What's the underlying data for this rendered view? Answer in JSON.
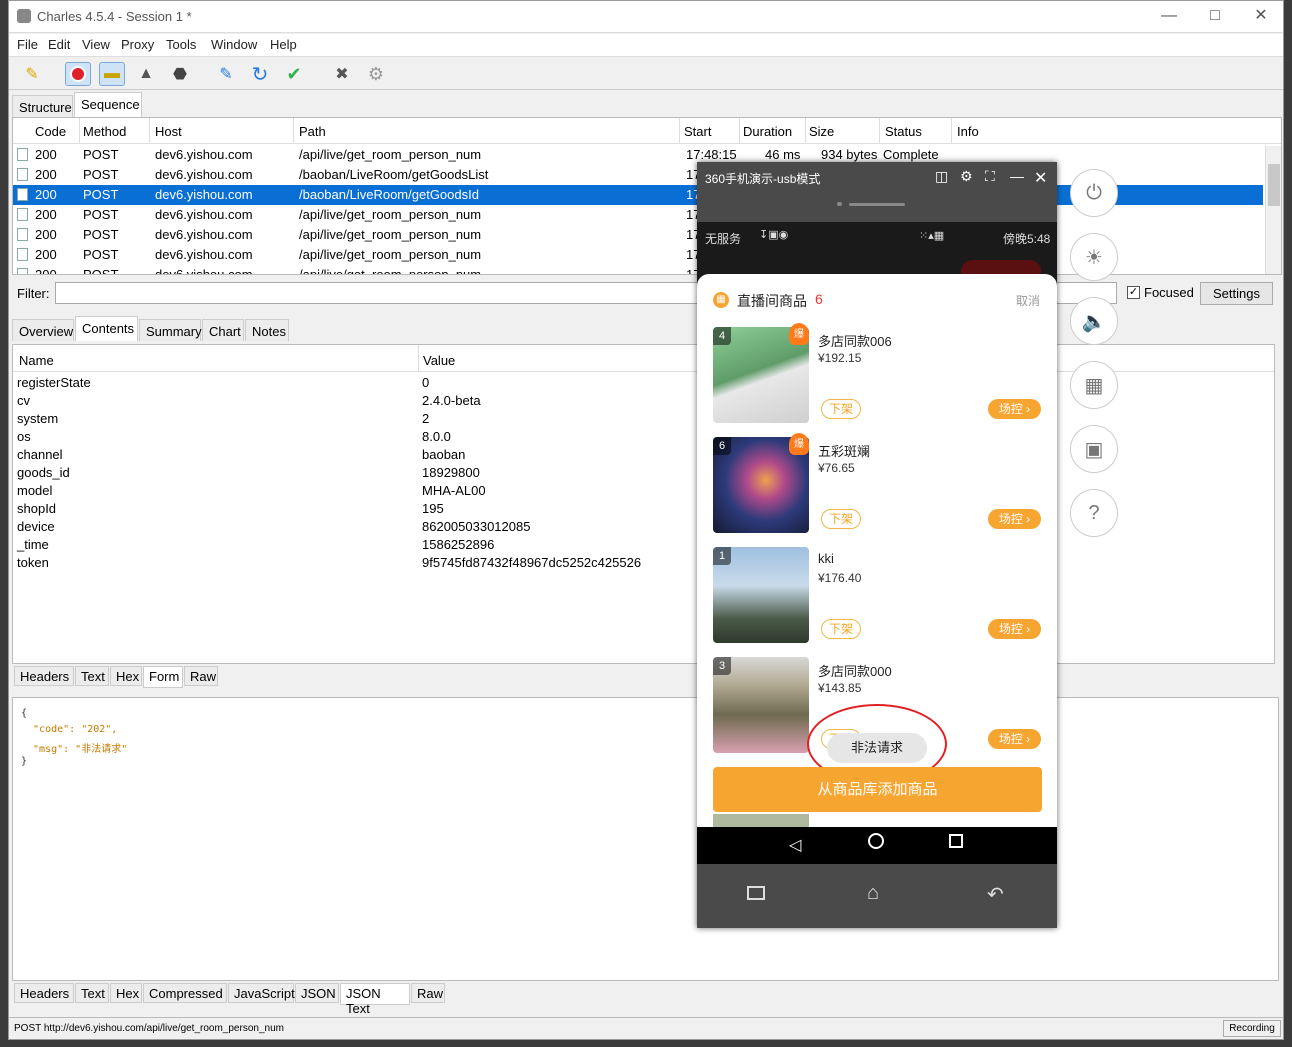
{
  "window": {
    "title": "Charles 4.5.4 - Session 1 *"
  },
  "menu": [
    "File",
    "Edit",
    "View",
    "Proxy",
    "Tools",
    "Window",
    "Help"
  ],
  "toolbar": {
    "icons": [
      "broom-icon",
      "record-icon",
      "throttle-icon",
      "turtle-icon",
      "stop-icon",
      "pen-icon",
      "refresh-icon",
      "check-icon",
      "tools-icon",
      "gear-icon"
    ]
  },
  "view_tabs": [
    "Structure",
    "Sequence"
  ],
  "sequence": {
    "columns": [
      "Code",
      "Method",
      "Host",
      "Path",
      "Start",
      "Duration",
      "Size",
      "Status",
      "Info"
    ],
    "rows": [
      {
        "code": "200",
        "method": "POST",
        "host": "dev6.yishou.com",
        "path": "/api/live/get_room_person_num",
        "start": "17:48:15",
        "duration": "46 ms",
        "size": "934 bytes",
        "status": "Complete"
      },
      {
        "code": "200",
        "method": "POST",
        "host": "dev6.yishou.com",
        "path": "/baoban/LiveRoom/getGoodsList",
        "start": "17"
      },
      {
        "code": "200",
        "method": "POST",
        "host": "dev6.yishou.com",
        "path": "/baoban/LiveRoom/getGoodsId",
        "start": "17"
      },
      {
        "code": "200",
        "method": "POST",
        "host": "dev6.yishou.com",
        "path": "/api/live/get_room_person_num",
        "start": "17"
      },
      {
        "code": "200",
        "method": "POST",
        "host": "dev6.yishou.com",
        "path": "/api/live/get_room_person_num",
        "start": "17"
      },
      {
        "code": "200",
        "method": "POST",
        "host": "dev6.yishou.com",
        "path": "/api/live/get_room_person_num",
        "start": "17"
      },
      {
        "code": "200",
        "method": "POST",
        "host": "dev6.yishou.com",
        "path": "/api/live/get_room_person_num",
        "start": "17"
      }
    ]
  },
  "filter": {
    "label": "Filter:",
    "value": "",
    "focused_label": "Focused",
    "settings_label": "Settings"
  },
  "detail_tabs": [
    "Overview",
    "Contents",
    "Summary",
    "Chart",
    "Notes"
  ],
  "form": {
    "columns": [
      "Name",
      "Value"
    ],
    "rows": [
      [
        "registerState",
        "0"
      ],
      [
        "cv",
        "2.4.0-beta"
      ],
      [
        "system",
        "2"
      ],
      [
        "os",
        "8.0.0"
      ],
      [
        "channel",
        "baoban"
      ],
      [
        "goods_id",
        "18929800"
      ],
      [
        "model",
        "MHA-AL00"
      ],
      [
        "shopId",
        "195"
      ],
      [
        "device",
        "862005033012085"
      ],
      [
        "_time",
        "1586252896"
      ],
      [
        "token",
        "9f5745fd87432f48967dc5252c425526"
      ]
    ]
  },
  "request_tabs": [
    "Headers",
    "Text",
    "Hex",
    "Form",
    "Raw"
  ],
  "response_body": {
    "line1": "{",
    "line2": "  \"code\": \"202\",",
    "line3": "  \"msg\": \"非法请求\"",
    "line4": "}"
  },
  "response_tabs": [
    "Headers",
    "Text",
    "Hex",
    "Compressed",
    "JavaScript",
    "JSON",
    "JSON Text",
    "Raw"
  ],
  "status_bar": {
    "text": "POST http://dev6.yishou.com/api/live/get_room_person_num",
    "recording": "Recording"
  },
  "phone": {
    "title": "360手机演示-usb模式",
    "status_left": "无服务",
    "status_right": "傍晚5:48",
    "sheet_title": "直播间商品",
    "count": "6",
    "cancel": "取消",
    "items": [
      {
        "num": "4",
        "hot": "爆",
        "name": "多店同款006",
        "price": "¥192.15",
        "off": "下架",
        "ctl": "场控 ›",
        "color": "#7fb98a"
      },
      {
        "num": "6",
        "hot": "爆",
        "name": "五彩斑斓",
        "price": "¥76.65",
        "off": "下架",
        "ctl": "场控 ›",
        "color": "#3a3a6e"
      },
      {
        "num": "1",
        "hot": "",
        "name": "kki",
        "price": "¥176.40",
        "off": "下架",
        "ctl": "场控 ›",
        "color": "#6d8fb5"
      },
      {
        "num": "3",
        "hot": "",
        "name": "多店同款000",
        "price": "¥143.85",
        "off": "下架",
        "ctl": "场控 ›",
        "color": "#7a6a50"
      }
    ],
    "toast": "非法请求",
    "add_button": "从商品库添加商品"
  },
  "accent": "#0a6fd4"
}
